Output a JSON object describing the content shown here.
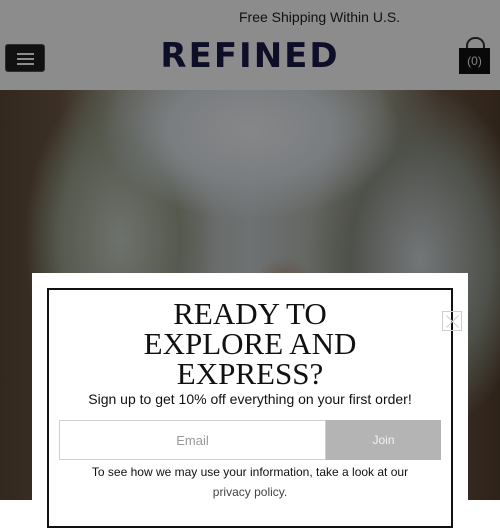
{
  "announcement": {
    "text": "Free Shipping Within U.S."
  },
  "header": {
    "menu_icon": "hamburger-menu-icon",
    "logo": "REFINED",
    "cart": {
      "icon": "shopping-bag-icon",
      "count_label": "(0)"
    }
  },
  "hero": {
    "image": "woman-portrait-with-trees"
  },
  "popup": {
    "close_icon": "close-icon",
    "headline_lines": [
      "READY TO",
      "EXPLORE AND",
      "EXPRESS?"
    ],
    "subheadline": "Sign up to get 10% off everything on your first order!",
    "email_placeholder": "Email",
    "email_value": "",
    "join_label": "Join",
    "privacy_text": "To see how we may use your information, take a look at our",
    "privacy_link": "privacy policy."
  },
  "colors": {
    "logo": "#1d1a4b",
    "join_button": "#b4b4b4",
    "overlay": "rgba(0,0,0,0.45)"
  }
}
